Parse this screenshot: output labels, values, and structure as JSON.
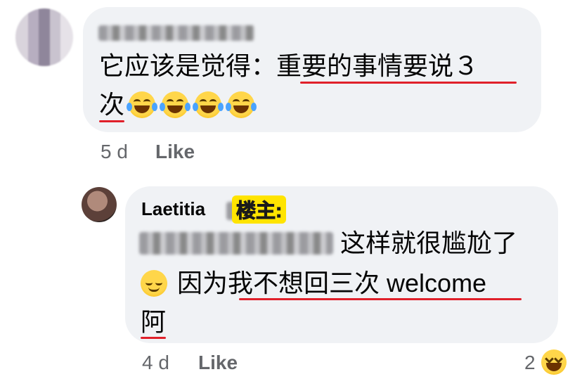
{
  "comment1": {
    "line1_pre": "它应该是觉得：",
    "line1_ul": "重要的事情要说３",
    "line2_ul": "次",
    "emoji_count": 4,
    "time": "5 d",
    "like_label": "Like"
  },
  "comment2": {
    "author": "Laetitia",
    "badge": "楼主:",
    "line1": "这样就很尴尬了",
    "line2_pre": "因为",
    "line2_ul": "我不想回三次",
    "line2_post": " welcome",
    "line3_ul": "阿",
    "time": "4 d",
    "like_label": "Like",
    "reaction_count": "2"
  },
  "colors": {
    "bubble": "#f0f2f5",
    "underline": "#e0202a",
    "badge": "#ffe400",
    "meta": "#65676b"
  }
}
